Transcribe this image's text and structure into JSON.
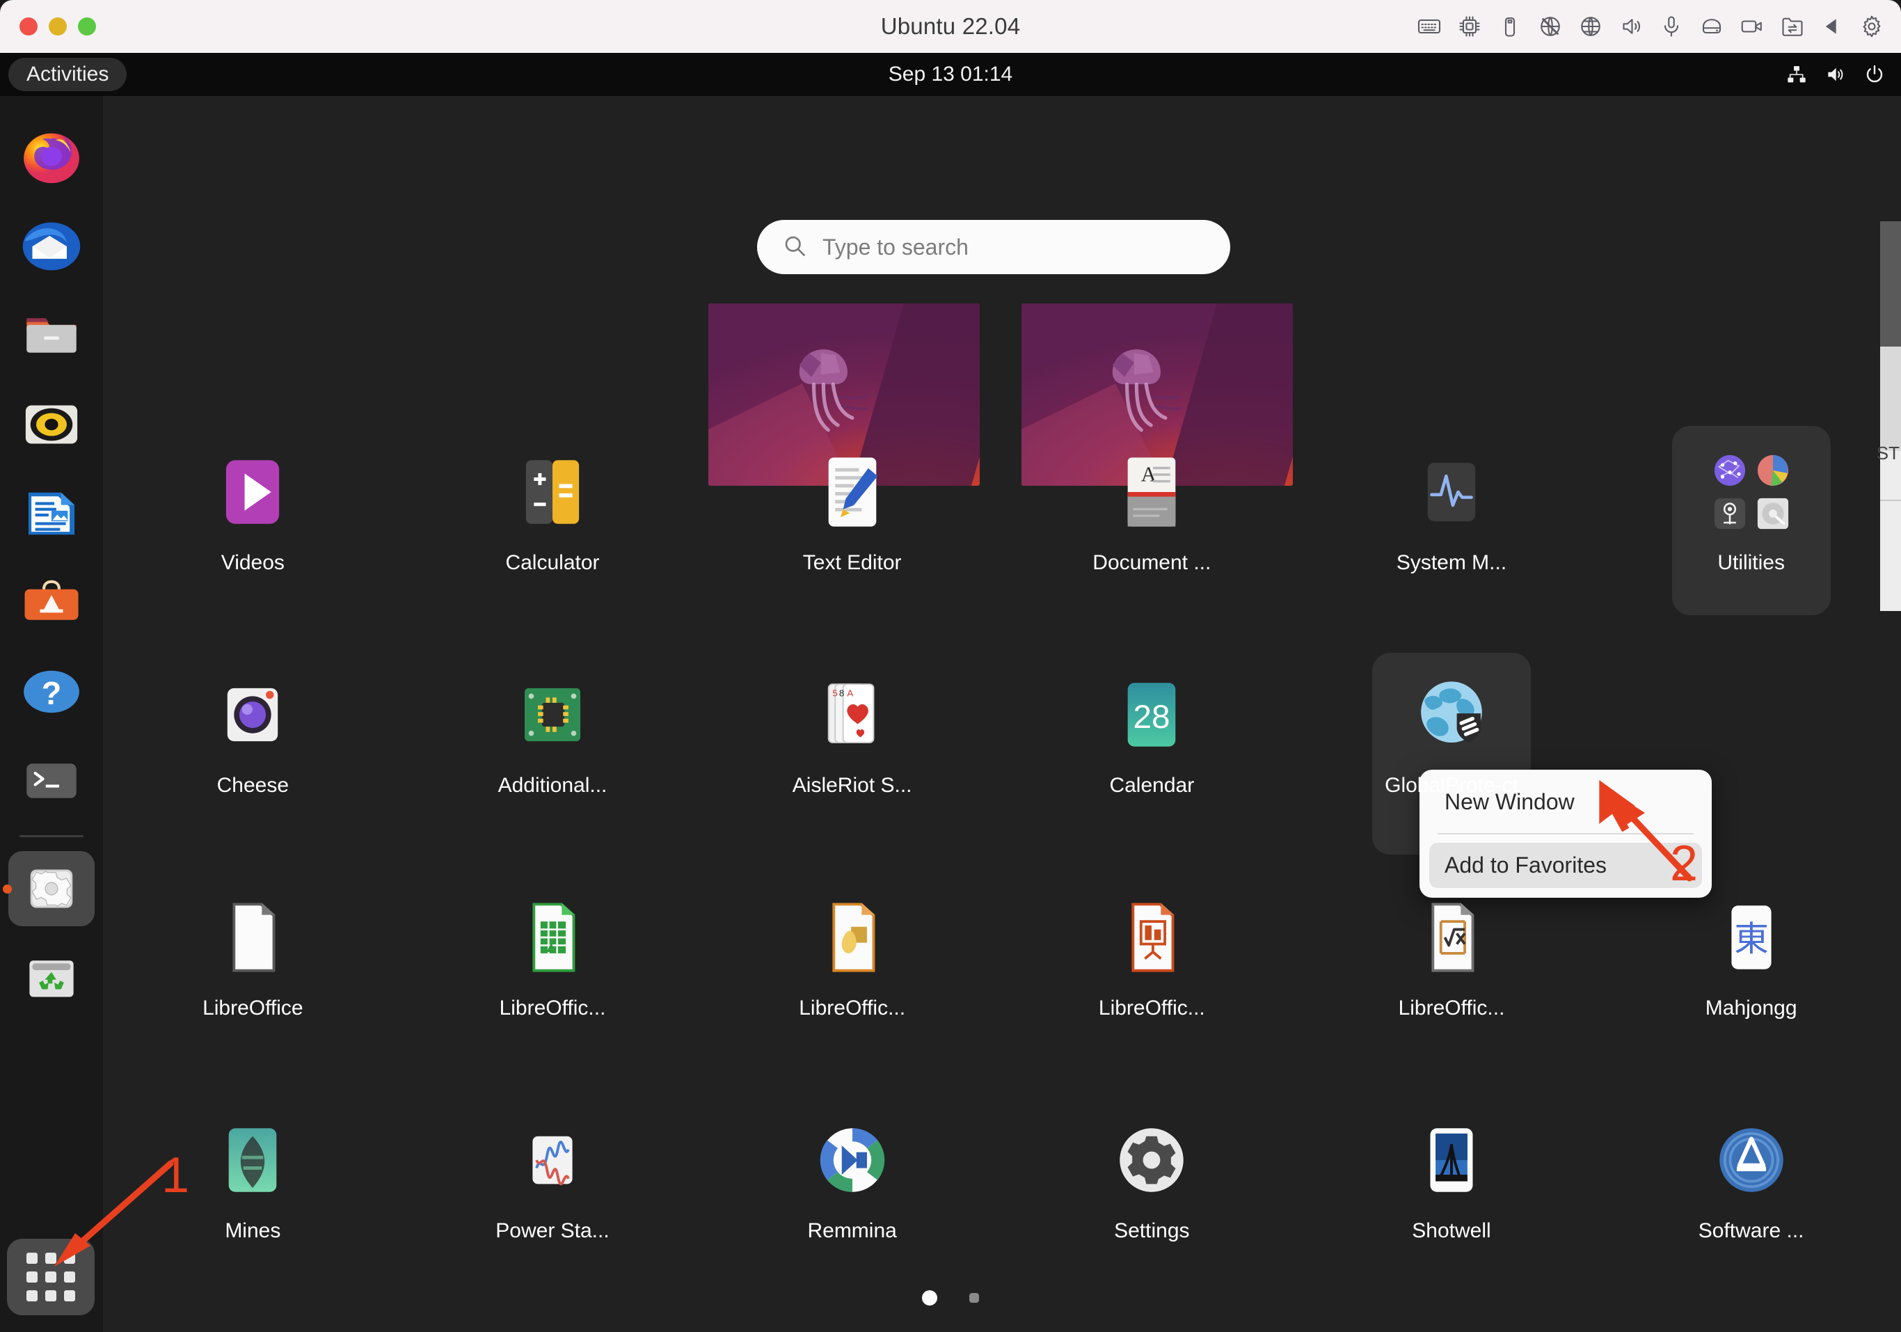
{
  "vm_window": {
    "title": "Ubuntu 22.04",
    "traffic_lights": [
      "close-button",
      "minimize-button",
      "maximize-button"
    ],
    "toolbar_icons": [
      "keyboard-icon",
      "cpu-icon",
      "usb-icon",
      "network-disabled-icon",
      "globe-icon",
      "speaker-icon",
      "microphone-icon",
      "harddisk-icon",
      "camera-icon",
      "shared-folder-icon",
      "play-back-icon",
      "settings-gear-icon"
    ]
  },
  "topbar": {
    "activities_label": "Activities",
    "clock": "Sep 13  01:14",
    "tray_icons": [
      "network-wired-icon",
      "volume-icon",
      "power-icon"
    ]
  },
  "search": {
    "placeholder": "Type to search",
    "icon": "search-icon"
  },
  "workspaces": [
    {
      "name": "workspace-1",
      "wallpaper": "ubuntu-jammy-jellyfish"
    },
    {
      "name": "workspace-2",
      "wallpaper": "ubuntu-jammy-jellyfish"
    }
  ],
  "dock": {
    "items": [
      {
        "name": "firefox",
        "icon": "firefox-icon",
        "active": false
      },
      {
        "name": "thunderbird",
        "icon": "thunderbird-icon",
        "active": false
      },
      {
        "name": "files",
        "icon": "files-folder-icon",
        "active": false
      },
      {
        "name": "rhythmbox",
        "icon": "rhythmbox-speaker-icon",
        "active": false
      },
      {
        "name": "libreoffice-writer",
        "icon": "libreoffice-writer-icon",
        "active": false
      },
      {
        "name": "ubuntu-software",
        "icon": "ubuntu-software-icon",
        "active": false
      },
      {
        "name": "help",
        "icon": "help-question-icon",
        "active": false
      },
      {
        "name": "terminal",
        "icon": "terminal-icon",
        "active": false
      },
      {
        "name": "settings",
        "icon": "settings-gear-icon",
        "active": true
      },
      {
        "name": "trash",
        "icon": "trash-recycle-icon",
        "active": false
      }
    ],
    "show_applications": {
      "label": "Show Applications",
      "icon": "app-grid-icon"
    }
  },
  "apps": [
    {
      "label": "Videos",
      "icon": "videos-icon",
      "selected": false,
      "folder": false
    },
    {
      "label": "Calculator",
      "icon": "calculator-icon",
      "selected": false,
      "folder": false
    },
    {
      "label": "Text Editor",
      "icon": "text-editor-icon",
      "selected": false,
      "folder": false
    },
    {
      "label": "Document ...",
      "icon": "document-viewer-icon",
      "selected": false,
      "folder": false
    },
    {
      "label": "System M...",
      "icon": "system-monitor-icon",
      "selected": false,
      "folder": false
    },
    {
      "label": "Utilities",
      "icon": "utilities-folder-icon",
      "selected": false,
      "folder": true
    },
    {
      "label": "Cheese",
      "icon": "cheese-camera-icon",
      "selected": false,
      "folder": false
    },
    {
      "label": "Additional...",
      "icon": "additional-drivers-icon",
      "selected": false,
      "folder": false
    },
    {
      "label": "AisleRiot S...",
      "icon": "aisleriot-cards-icon",
      "selected": false,
      "folder": false
    },
    {
      "label": "Calendar",
      "icon": "calendar-icon",
      "selected": false,
      "folder": false
    },
    {
      "label": "GlobalProte-ct",
      "icon": "globalprotect-icon",
      "selected": true,
      "folder": false
    },
    {
      "label": "",
      "icon": "",
      "selected": false,
      "folder": false
    },
    {
      "label": "LibreOffice",
      "icon": "libreoffice-start-icon",
      "selected": false,
      "folder": false
    },
    {
      "label": "LibreOffic...",
      "icon": "libreoffice-calc-icon",
      "selected": false,
      "folder": false
    },
    {
      "label": "LibreOffic...",
      "icon": "libreoffice-draw-icon",
      "selected": false,
      "folder": false
    },
    {
      "label": "LibreOffic...",
      "icon": "libreoffice-impress-icon",
      "selected": false,
      "folder": false
    },
    {
      "label": "LibreOffic...",
      "icon": "libreoffice-math-icon",
      "selected": false,
      "folder": false
    },
    {
      "label": "Mahjongg",
      "icon": "mahjongg-icon",
      "selected": false,
      "folder": false
    },
    {
      "label": "Mines",
      "icon": "mines-icon",
      "selected": false,
      "folder": false
    },
    {
      "label": "Power Sta...",
      "icon": "power-statistics-icon",
      "selected": false,
      "folder": false
    },
    {
      "label": "Remmina",
      "icon": "remmina-icon",
      "selected": false,
      "folder": false
    },
    {
      "label": "Settings",
      "icon": "settings-gear-icon",
      "selected": false,
      "folder": false
    },
    {
      "label": "Shotwell",
      "icon": "shotwell-icon",
      "selected": false,
      "folder": false
    },
    {
      "label": "Software ...",
      "icon": "software-updater-icon",
      "selected": false,
      "folder": false
    }
  ],
  "context_menu": {
    "items": [
      {
        "label": "New Window",
        "hovered": false
      },
      {
        "label": "Add to Favorites",
        "hovered": true
      }
    ]
  },
  "page_indicator": {
    "pages": 2,
    "current": 1
  },
  "annotations": [
    {
      "number": "1",
      "target": "show-applications-button"
    },
    {
      "number": "2",
      "target": "add-to-favorites-menu-item"
    }
  ],
  "colors": {
    "accent_orange": "#e8401f",
    "overview_bg": "#212121",
    "dock_bg": "#191919",
    "topbar_bg": "#0b0b0b",
    "selection_bg": "#323232"
  }
}
